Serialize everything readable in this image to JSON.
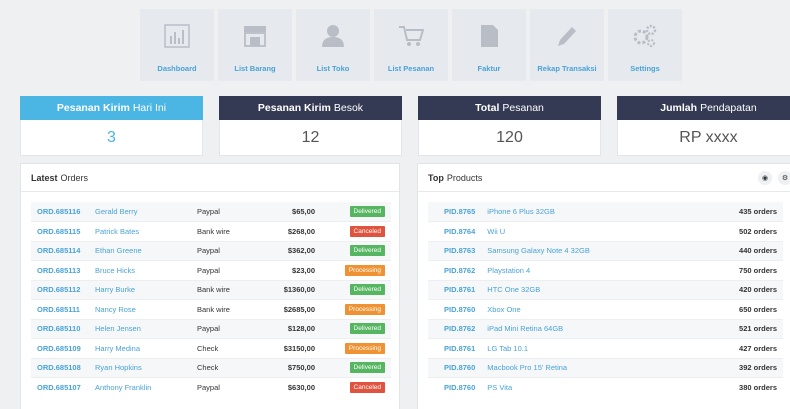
{
  "nav": [
    {
      "label": "Dashboard",
      "icon": "bar-chart-icon"
    },
    {
      "label": "List Barang",
      "icon": "store-icon"
    },
    {
      "label": "List Toko",
      "icon": "user-icon"
    },
    {
      "label": "List Pesanan",
      "icon": "cart-icon"
    },
    {
      "label": "Faktur",
      "icon": "document-icon"
    },
    {
      "label": "Rekap Transaksi",
      "icon": "pencil-icon"
    },
    {
      "label": "Settings",
      "icon": "gears-icon"
    }
  ],
  "stats": [
    {
      "bold": "Pesanan Kirim",
      "light": "Hari Ini",
      "value": "3"
    },
    {
      "bold": "Pesanan Kirim",
      "light": "Besok",
      "value": "12"
    },
    {
      "bold": "Total",
      "light": "Pesanan",
      "value": "120"
    },
    {
      "bold": "Jumlah",
      "light": "Pendapatan",
      "value": "RP xxxx"
    }
  ],
  "latest_orders": {
    "title_bold": "Latest",
    "title_light": "Orders",
    "rows": [
      {
        "id": "ORD.685116",
        "name": "Gerald Berry",
        "method": "Paypal",
        "amount": "$65,00",
        "status": "Delivered"
      },
      {
        "id": "ORD.685115",
        "name": "Patrick Bates",
        "method": "Bank wire",
        "amount": "$268,00",
        "status": "Canceled"
      },
      {
        "id": "ORD.685114",
        "name": "Ethan Greene",
        "method": "Paypal",
        "amount": "$362,00",
        "status": "Delivered"
      },
      {
        "id": "ORD.685113",
        "name": "Bruce Hicks",
        "method": "Paypal",
        "amount": "$23,00",
        "status": "Processing"
      },
      {
        "id": "ORD.685112",
        "name": "Harry Burke",
        "method": "Bank wire",
        "amount": "$1360,00",
        "status": "Delivered"
      },
      {
        "id": "ORD.685111",
        "name": "Nancy Rose",
        "method": "Bank wire",
        "amount": "$2685,00",
        "status": "Processing"
      },
      {
        "id": "ORD.685110",
        "name": "Helen Jensen",
        "method": "Paypal",
        "amount": "$128,00",
        "status": "Delivered"
      },
      {
        "id": "ORD.685109",
        "name": "Harry Medina",
        "method": "Check",
        "amount": "$3150,00",
        "status": "Processing"
      },
      {
        "id": "ORD.685108",
        "name": "Ryan Hopkins",
        "method": "Check",
        "amount": "$750,00",
        "status": "Delivered"
      },
      {
        "id": "ORD.685107",
        "name": "Anthony Franklin",
        "method": "Paypal",
        "amount": "$630,00",
        "status": "Canceled"
      }
    ]
  },
  "top_products": {
    "title_bold": "Top",
    "title_light": "Products",
    "rows": [
      {
        "id": "PID.8765",
        "name": "iPhone 6 Plus 32GB",
        "orders": "435 orders"
      },
      {
        "id": "PID.8764",
        "name": "Wii U",
        "orders": "502 orders"
      },
      {
        "id": "PID.8763",
        "name": "Samsung Galaxy Note 4 32GB",
        "orders": "440 orders"
      },
      {
        "id": "PID.8762",
        "name": "Playstation 4",
        "orders": "750 orders"
      },
      {
        "id": "PID.8761",
        "name": "HTC One 32GB",
        "orders": "420 orders"
      },
      {
        "id": "PID.8760",
        "name": "Xbox One",
        "orders": "650 orders"
      },
      {
        "id": "PID.8762",
        "name": "iPad Mini Retina 64GB",
        "orders": "521 orders"
      },
      {
        "id": "PID.8761",
        "name": "LG Tab 10.1",
        "orders": "427 orders"
      },
      {
        "id": "PID.8760",
        "name": "Macbook Pro 15' Retina",
        "orders": "392 orders"
      },
      {
        "id": "PID.8760",
        "name": "PS Vita",
        "orders": "380 orders"
      }
    ]
  },
  "colors": {
    "accent": "#4bb5e4",
    "dark": "#353a54",
    "delivered": "#55b561",
    "canceled": "#e0533f",
    "processing": "#ee9233"
  }
}
